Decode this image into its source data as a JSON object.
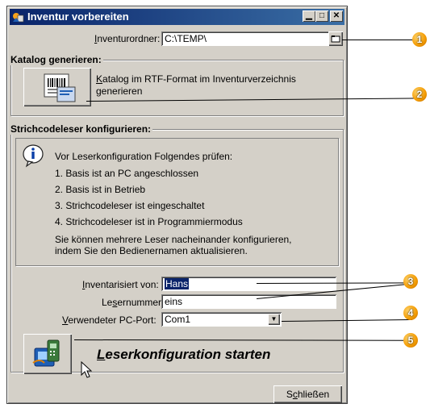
{
  "window": {
    "title": "Inventur vorbereiten",
    "controls": [
      "minimize-icon",
      "maximize-icon",
      "close-icon"
    ]
  },
  "folder": {
    "label": "Inventurordner:",
    "value": "C:\\TEMP\\"
  },
  "catalog": {
    "group_title": "Katalog generieren:",
    "description_line1": "Katalog im RTF-Format im Inventurverzeichnis",
    "description_line2": "generieren"
  },
  "scanner": {
    "group_title": "Strichcodeleser konfigurieren:",
    "info_heading": "Vor Leserkonfiguration Folgendes prüfen:",
    "steps": [
      "1. Basis ist an PC angeschlossen",
      "2. Basis ist in Betrieb",
      "3. Strichcodeleser ist eingeschaltet",
      "4. Strichcodeleser ist in Programmiermodus"
    ],
    "note_line1": "Sie können mehrere Leser nacheinander konfigurieren,",
    "note_line2": "indem Sie den Bedienernamen aktualisieren."
  },
  "form": {
    "inventoried_by_label": "Inventarisiert von:",
    "inventoried_by_value": "Hans",
    "reader_number_label": "Lesernummer:",
    "reader_number_value": "eins",
    "pc_port_label": "Verwendeter PC-Port:",
    "pc_port_value": "Com1"
  },
  "actions": {
    "start_label": "Leserkonfiguration starten",
    "close_label": "Schließen"
  },
  "callouts": [
    "1",
    "2",
    "3",
    "4",
    "5"
  ],
  "colors": {
    "titlebar_start": "#0a246a",
    "titlebar_end": "#3a6ea5",
    "dialog_bg": "#d4d0c8",
    "callout": "#f39a00",
    "selection": "#0a246a"
  }
}
